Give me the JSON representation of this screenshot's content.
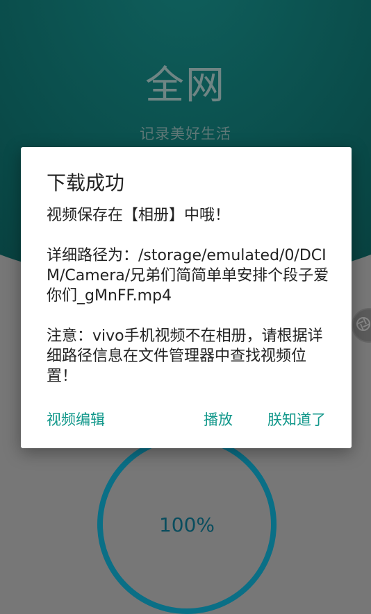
{
  "background": {
    "app_title": "全网",
    "slogan": "记录美好生活",
    "progress": {
      "label": "100%",
      "value": 1.0
    }
  },
  "dialog": {
    "title": "下载成功",
    "message": "视频保存在【相册】中哦！\n\n详细路径为：/storage/emulated/0/DCIM/Camera/兄弟们简简单单安排个段子爱你们_gMnFF.mp4\n\n注意：vivo手机视频不在相册，请根据详细路径信息在文件管理器中查找视频位置！",
    "buttons": {
      "edit": "视频编辑",
      "play": "播放",
      "ok": "朕知道了"
    }
  },
  "colors": {
    "accent": "#10978a",
    "hero": "#0a4c4a",
    "scrim": "#777777",
    "ring": "#0a6f86"
  },
  "icons": {
    "side_handle": "aperture-icon"
  }
}
